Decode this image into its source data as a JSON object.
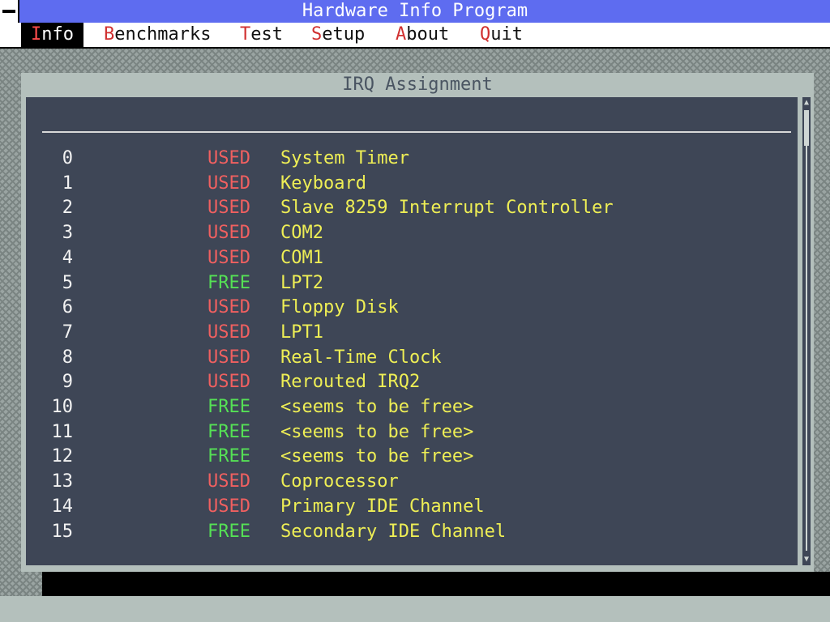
{
  "app": {
    "title": "Hardware Info Program"
  },
  "menu": [
    {
      "hotkey": "I",
      "rest": "nfo",
      "selected": true
    },
    {
      "hotkey": "B",
      "rest": "enchmarks",
      "selected": false
    },
    {
      "hotkey": "T",
      "rest": "est",
      "selected": false
    },
    {
      "hotkey": "S",
      "rest": "etup",
      "selected": false
    },
    {
      "hotkey": "A",
      "rest": "bout",
      "selected": false
    },
    {
      "hotkey": "Q",
      "rest": "uit",
      "selected": false
    }
  ],
  "window": {
    "title": "IRQ Assignment"
  },
  "irq_table": [
    {
      "irq": "0",
      "status": "USED",
      "description": "System Timer"
    },
    {
      "irq": "1",
      "status": "USED",
      "description": "Keyboard"
    },
    {
      "irq": "2",
      "status": "USED",
      "description": "Slave 8259 Interrupt Controller"
    },
    {
      "irq": "3",
      "status": "USED",
      "description": "COM2"
    },
    {
      "irq": "4",
      "status": "USED",
      "description": "COM1"
    },
    {
      "irq": "5",
      "status": "FREE",
      "description": "LPT2"
    },
    {
      "irq": "6",
      "status": "USED",
      "description": "Floppy Disk"
    },
    {
      "irq": "7",
      "status": "USED",
      "description": "LPT1"
    },
    {
      "irq": "8",
      "status": "USED",
      "description": "Real-Time Clock"
    },
    {
      "irq": "9",
      "status": "USED",
      "description": "Rerouted IRQ2"
    },
    {
      "irq": "10",
      "status": "FREE",
      "description": "<seems to be free>"
    },
    {
      "irq": "11",
      "status": "FREE",
      "description": "<seems to be free>"
    },
    {
      "irq": "12",
      "status": "FREE",
      "description": "<seems to be free>"
    },
    {
      "irq": "13",
      "status": "USED",
      "description": "Coprocessor"
    },
    {
      "irq": "14",
      "status": "USED",
      "description": "Primary IDE Channel"
    },
    {
      "irq": "15",
      "status": "FREE",
      "description": "Secondary IDE Channel"
    }
  ],
  "colors": {
    "title_bar": "#5e6cf0",
    "used": "#f06060",
    "free": "#55e055",
    "description": "#eeee55",
    "content_bg": "#3e4656"
  },
  "icons": {
    "system_menu": "system-menu-icon",
    "scroll_up": "scroll-up-arrow-icon",
    "scroll_down": "scroll-down-arrow-icon"
  }
}
